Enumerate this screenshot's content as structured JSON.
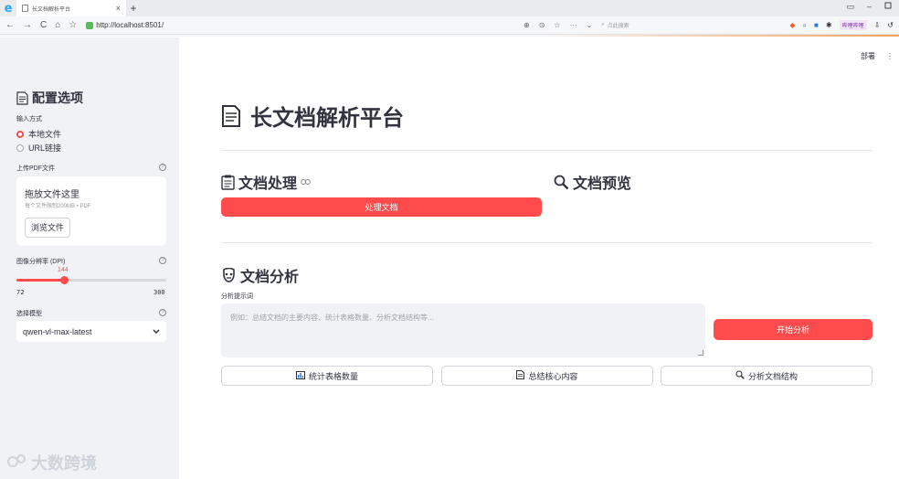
{
  "browser": {
    "logo": "e",
    "tab_title": "长文档解析平台",
    "tab_close": "×",
    "new_tab": "+",
    "url": "http://localhost:8501/",
    "search_placeholder": "点此搜索",
    "extension_badge": "哔哩哔哩",
    "win_minimize": "–",
    "win_restore": "▭"
  },
  "sidebar": {
    "title": "配置选项",
    "input_mode_label": "输入方式",
    "input_options": [
      {
        "label": "本地文件",
        "selected": true
      },
      {
        "label": "URL链接",
        "selected": false
      }
    ],
    "upload_label": "上传PDF文件",
    "uploader": {
      "title": "拖放文件这里",
      "subtitle": "每个文件限制200MB • PDF",
      "browse_button": "浏览文件"
    },
    "dpi_label": "图像分辨率 (DPI)",
    "dpi": {
      "value": "144",
      "min": "72",
      "max": "300",
      "fraction": 0.3158
    },
    "model_label": "选择模型",
    "model_value": "qwen-vl-max-latest",
    "watermark": "大数跨境"
  },
  "main": {
    "deploy": "部署",
    "menu": "⋮",
    "title": "长文档解析平台",
    "section_process": "文档处理",
    "process_button": "处理文档",
    "section_preview": "文档预览",
    "section_analysis": "文档分析",
    "prompt_label": "分析提示词",
    "prompt_placeholder": "例如：总结文档的主要内容、统计表格数量、分析文档结构等...",
    "start_button": "开始分析",
    "quick_buttons": [
      {
        "label": "统计表格数量",
        "icon": "chart-icon"
      },
      {
        "label": "总结核心内容",
        "icon": "document-icon"
      },
      {
        "label": "分析文档结构",
        "icon": "magnifier-icon"
      }
    ]
  },
  "colors": {
    "accent": "#ff4b4b",
    "sidebar_bg": "#f0f2f6",
    "text": "#31333f"
  }
}
